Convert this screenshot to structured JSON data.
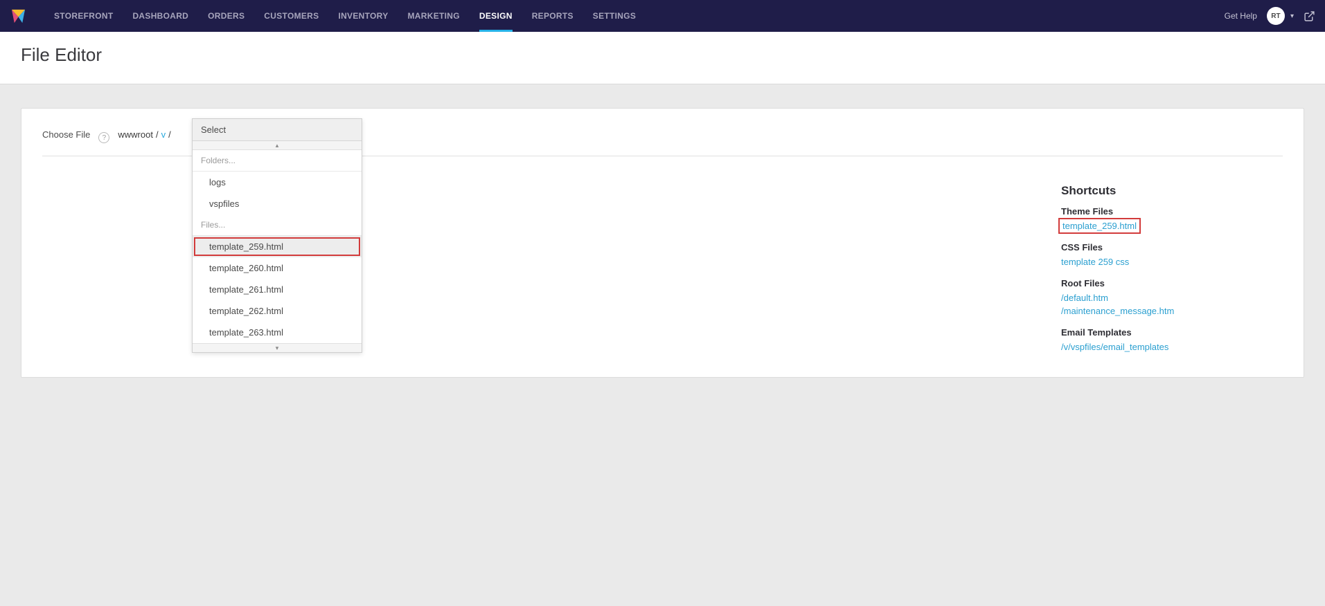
{
  "nav": {
    "items": [
      "STOREFRONT",
      "DASHBOARD",
      "ORDERS",
      "CUSTOMERS",
      "INVENTORY",
      "MARKETING",
      "DESIGN",
      "REPORTS",
      "SETTINGS"
    ],
    "active_index": 6,
    "get_help": "Get Help",
    "avatar": "RT"
  },
  "page": {
    "title": "File Editor"
  },
  "choose": {
    "label": "Choose File",
    "breadcrumb": {
      "root": "wwwroot",
      "v": "v",
      "sep": "/"
    }
  },
  "dropdown": {
    "header": "Select",
    "section_folders": "Folders...",
    "folders": [
      "logs",
      "vspfiles"
    ],
    "section_files": "Files...",
    "files": [
      "template_259.html",
      "template_260.html",
      "template_261.html",
      "template_262.html",
      "template_263.html"
    ],
    "highlight_file_index": 0
  },
  "shortcuts": {
    "title": "Shortcuts",
    "groups": [
      {
        "title": "Theme Files",
        "links": [
          "template_259.html"
        ],
        "highlight_index": 0
      },
      {
        "title": "CSS Files",
        "links": [
          "template 259 css"
        ]
      },
      {
        "title": "Root Files",
        "links": [
          "/default.htm",
          "/maintenance_message.htm"
        ]
      },
      {
        "title": "Email Templates",
        "links": [
          "/v/vspfiles/email_templates"
        ]
      }
    ]
  }
}
